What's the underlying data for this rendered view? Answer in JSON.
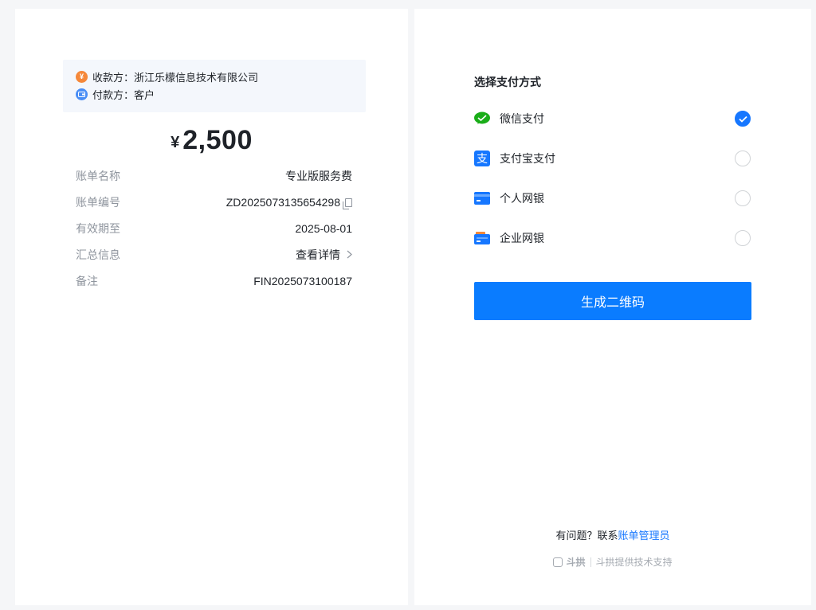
{
  "bill": {
    "payee_label": "收款方：",
    "payee_name": "浙江乐檬信息技术有限公司",
    "payer_label": "付款方：",
    "payer_name": "客户",
    "currency_symbol": "¥",
    "amount": "2,500",
    "rows": [
      {
        "key": "账单名称",
        "value": "专业版服务费"
      },
      {
        "key": "账单编号",
        "value": "ZD2025073135654298"
      },
      {
        "key": "有效期至",
        "value": "2025-08-01"
      },
      {
        "key": "汇总信息",
        "value": "查看详情"
      },
      {
        "key": "备注",
        "value": "FIN2025073100187"
      }
    ]
  },
  "payment": {
    "title": "选择支付方式",
    "methods": [
      {
        "label": "微信支付",
        "icon": "wechat-pay-icon",
        "selected": true,
        "color": "#1aad19"
      },
      {
        "label": "支付宝支付",
        "icon": "alipay-icon",
        "selected": false,
        "color": "#1677ff"
      },
      {
        "label": "个人网银",
        "icon": "personal-bank-card-icon",
        "selected": false,
        "color": "#1677ff"
      },
      {
        "label": "企业网银",
        "icon": "enterprise-bank-card-icon",
        "selected": false,
        "color": "#1677ff"
      }
    ],
    "generate_button": "生成二维码",
    "help_prefix": "有问题？联系",
    "help_link": "账单管理员",
    "brand_name": "斗拱",
    "powered_by": "斗拱提供技术支持"
  },
  "colors": {
    "accent": "#0a7cff",
    "background": "#f5f6f8"
  }
}
